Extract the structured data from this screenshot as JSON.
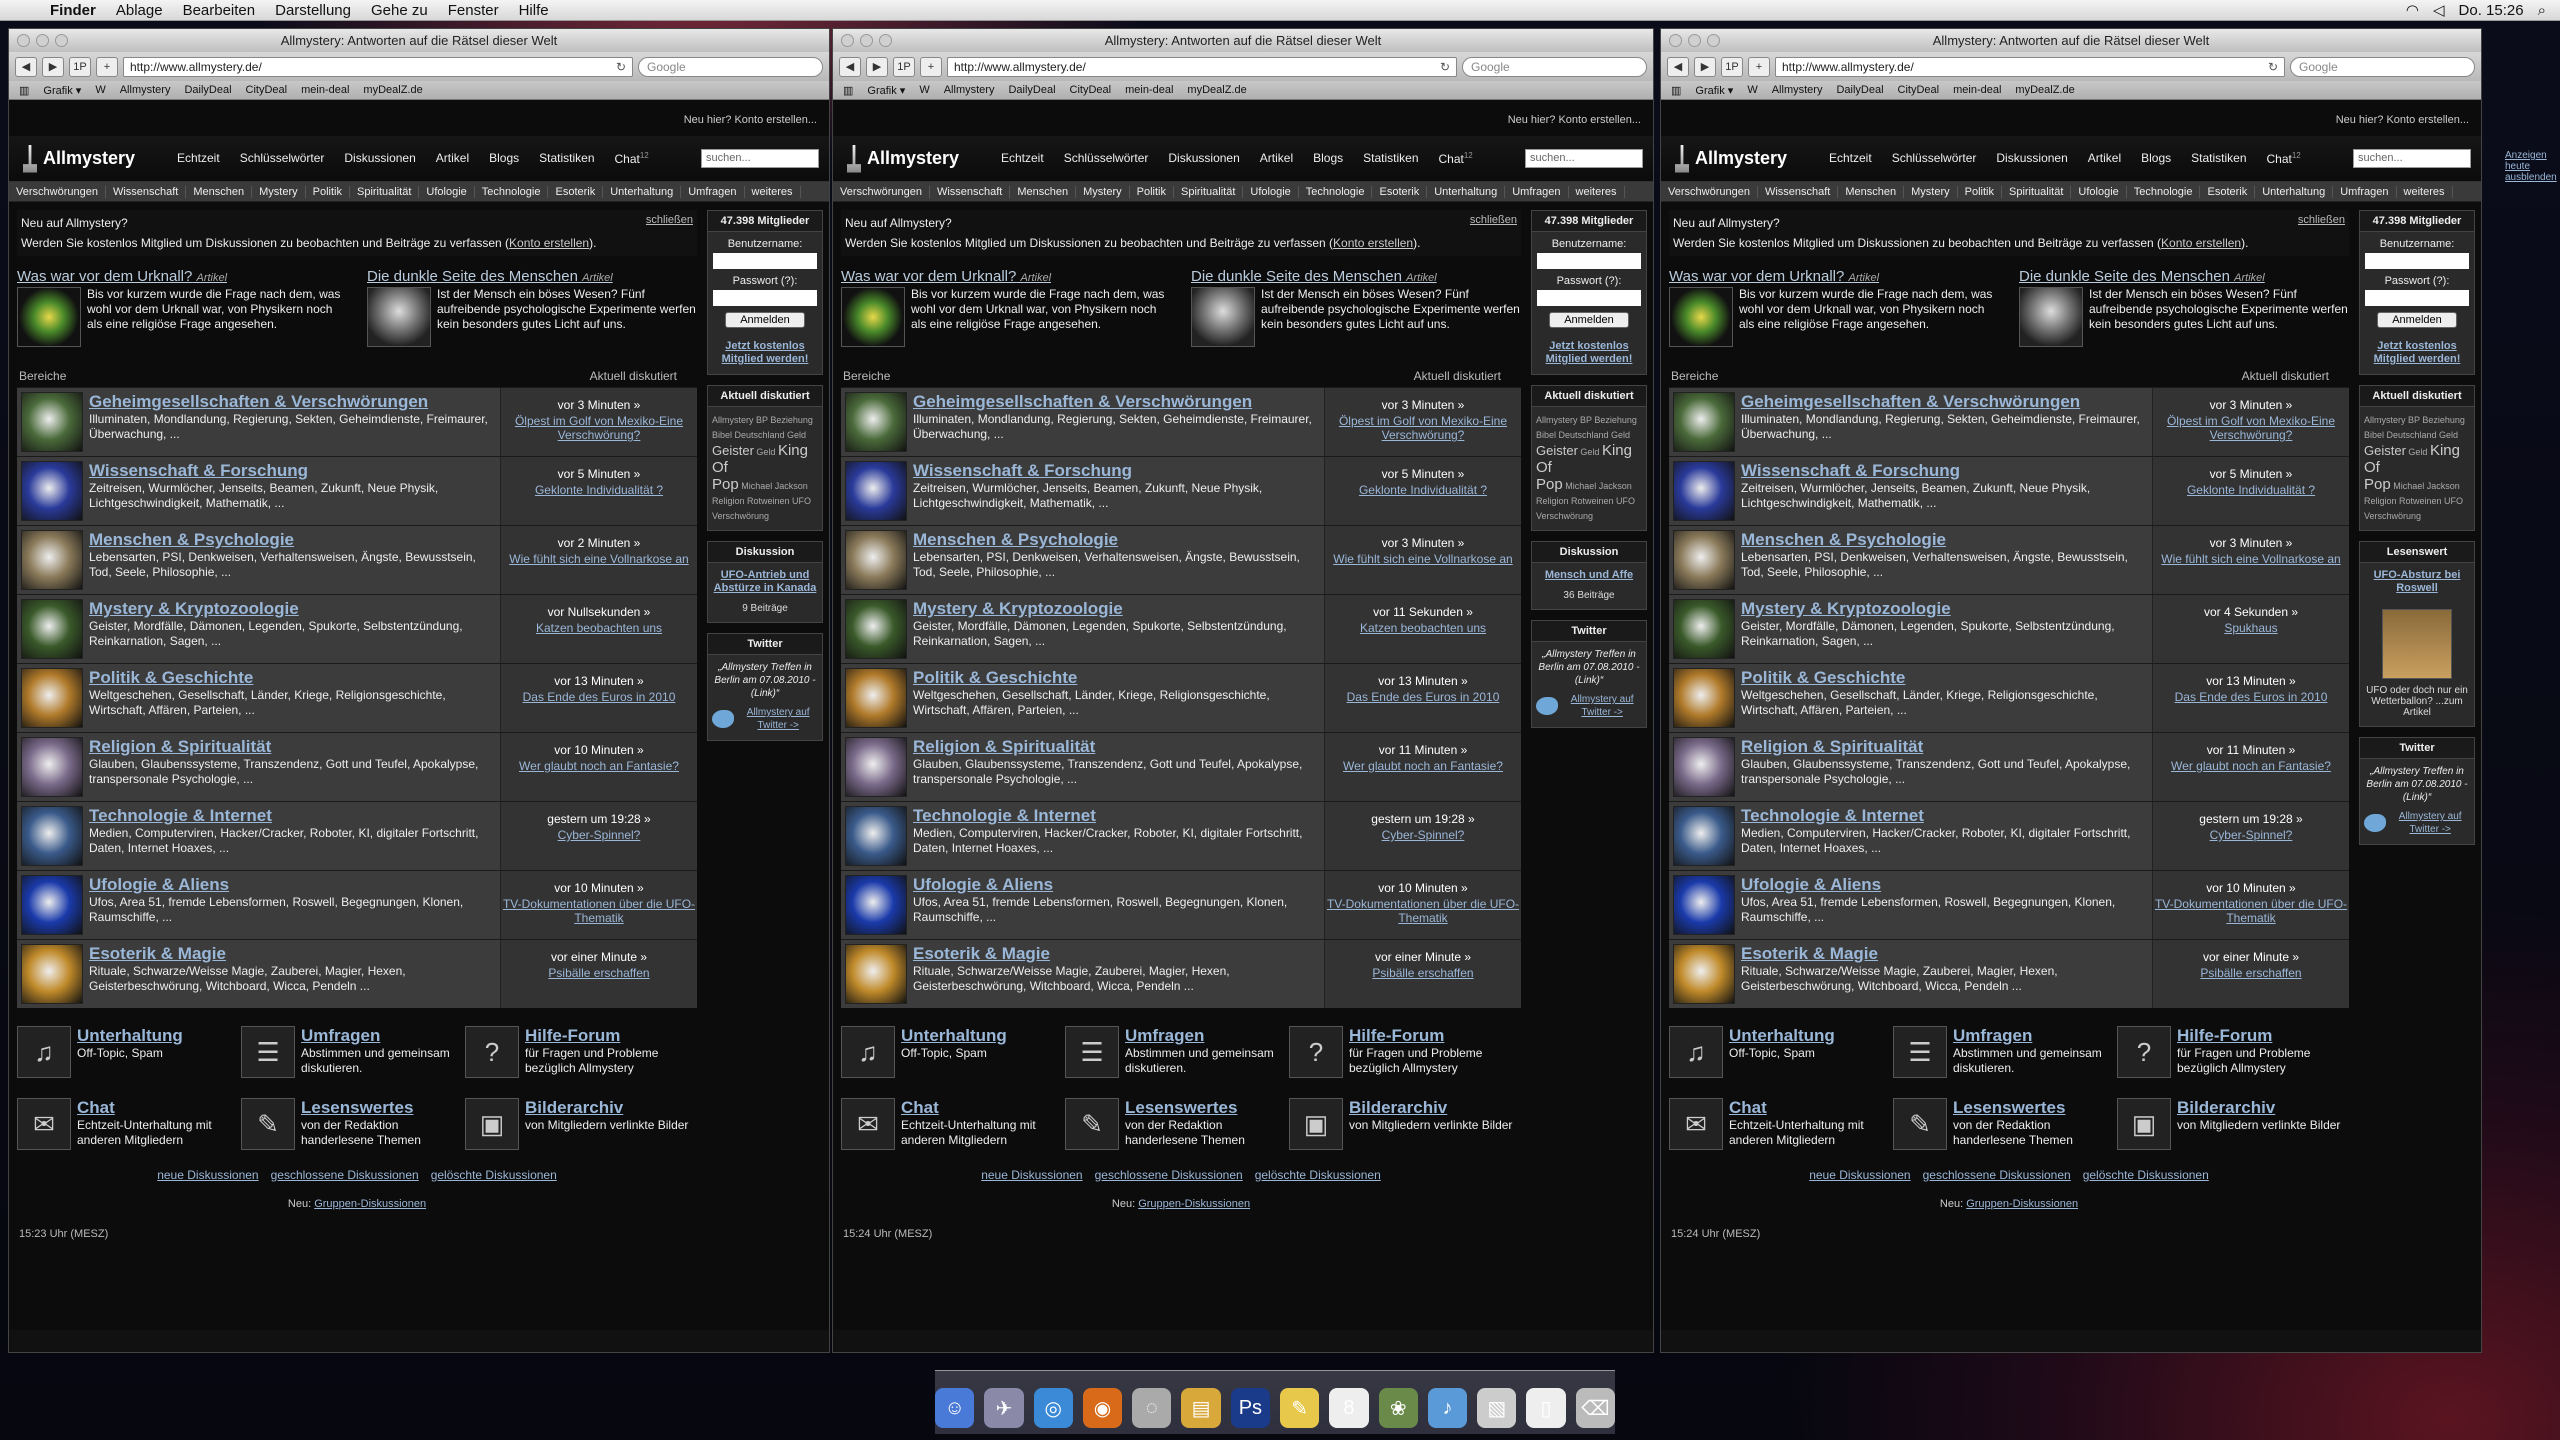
{
  "menubar": {
    "items": [
      "Finder",
      "Ablage",
      "Bearbeiten",
      "Darstellung",
      "Gehe zu",
      "Fenster",
      "Hilfe"
    ],
    "clock": "Do. 15:26"
  },
  "browser": {
    "title": "Allmystery: Antworten auf die Rätsel dieser Welt",
    "url": "http://www.allmystery.de/",
    "google": "Google",
    "bookmarks": [
      "Grafik ▾",
      "W",
      "Allmystery",
      "DailyDeal",
      "CityDeal",
      "mein-deal",
      "myDealZ.de"
    ]
  },
  "site": {
    "newhere": "Neu hier? Konto erstellen...",
    "logo": "Allmystery",
    "nav": [
      "Echtzeit",
      "Schlüsselwörter",
      "Diskussionen",
      "Artikel",
      "Blogs",
      "Statistiken",
      "Chat"
    ],
    "chat_count": "12",
    "search_placeholder": "suchen...",
    "categories": [
      "Verschwörungen",
      "Wissenschaft",
      "Menschen",
      "Mystery",
      "Politik",
      "Spiritualität",
      "Ufologie",
      "Technologie",
      "Esoterik",
      "Unterhaltung",
      "Umfragen",
      "weiteres"
    ],
    "welcome": {
      "title": "Neu auf Allmystery?",
      "text": "Werden Sie kostenlos Mitglied um Diskussionen zu beobachten und Beiträge zu verfassen (",
      "link": "Konto erstellen",
      "end": ").",
      "close": "schließen"
    },
    "features": [
      {
        "title": "Was war vor dem Urknall?",
        "type": "Artikel",
        "text": "Bis vor kurzem wurde die Frage nach dem, was wohl vor dem Urknall war, von Physikern noch als eine religiöse Frage angesehen."
      },
      {
        "title": "Die dunkle Seite des Menschen",
        "type": "Artikel",
        "text": "Ist der Mensch ein böses Wesen? Fünf aufreibende psychologische Experimente werfen kein besonders gutes Licht auf uns."
      }
    ],
    "bereiche": "Bereiche",
    "aktuell": "Aktuell diskutiert",
    "forums": [
      {
        "title": "Geheimgesellschaften & Verschwörungen",
        "desc": "Illuminaten, Mondlandung, Regierung, Sekten, Geheimdienste, Freimaurer, Überwachung, ...",
        "color": "#4a6a3a"
      },
      {
        "title": "Wissenschaft & Forschung",
        "desc": "Zeitreisen, Wurmlöcher, Jenseits, Beamen, Zukunft, Neue Physik, Lichtgeschwindigkeit, Mathematik, ...",
        "color": "#2a3a9a"
      },
      {
        "title": "Menschen & Psychologie",
        "desc": "Lebensarten, PSI, Denkweisen, Verhaltensweisen, Ängste, Bewusstsein, Tod, Seele, Philosophie, ...",
        "color": "#8a7a5a"
      },
      {
        "title": "Mystery & Kryptozoologie",
        "desc": "Geister, Mordfälle, Dämonen, Legenden, Spukorte, Selbstentzündung, Reinkarnation, Sagen, ...",
        "color": "#3a5a2a"
      },
      {
        "title": "Politik & Geschichte",
        "desc": "Weltgeschehen, Gesellschaft, Länder, Kriege, Religionsgeschichte, Wirtschaft, Affären, Parteien, ...",
        "color": "#b07a2a"
      },
      {
        "title": "Religion & Spiritualität",
        "desc": "Glauben, Glaubenssysteme, Transzendenz, Gott und Teufel, Apokalypse, transpersonale Psychologie, ...",
        "color": "#7a6a8a"
      },
      {
        "title": "Technologie & Internet",
        "desc": "Medien, Computerviren, Hacker/Cracker, Roboter, KI, digitaler Fortschritt, Daten, Internet Hoaxes, ...",
        "color": "#3a5a8a"
      },
      {
        "title": "Ufologie & Aliens",
        "desc": "Ufos, Area 51, fremde Lebensformen, Roswell, Begegnungen, Klonen, Raumschiffe, ...",
        "color": "#1a3aaa"
      },
      {
        "title": "Esoterik & Magie",
        "desc": "Rituale, Schwarze/Weisse Magie, Zauberei, Magier, Hexen, Geisterbeschwörung, Witchboard, Wicca, Pendeln ...",
        "color": "#c08a2a"
      }
    ],
    "extras": [
      {
        "title": "Unterhaltung",
        "desc": "Off-Topic, Spam",
        "icon": "♫"
      },
      {
        "title": "Umfragen",
        "desc": "Abstimmen und gemeinsam diskutieren.",
        "icon": "☰"
      },
      {
        "title": "Hilfe-Forum",
        "desc": "für Fragen und Probleme bezüglich Allmystery",
        "icon": "?"
      },
      {
        "title": "Chat",
        "desc": "Echtzeit-Unterhaltung mit anderen Mitgliedern",
        "icon": "✉"
      },
      {
        "title": "Lesenswertes",
        "desc": "von der Redaktion handerlesene Themen",
        "icon": "✎"
      },
      {
        "title": "Bilderarchiv",
        "desc": "von Mitgliedern verlinkte Bilder",
        "icon": "▣"
      }
    ],
    "footlinks": [
      "neue Diskussionen",
      "geschlossene Diskussionen",
      "gelöschte Diskussionen"
    ],
    "neu_label": "Neu:",
    "neu_link": "Gruppen-Diskussionen",
    "members": "47.398 Mitglieder",
    "username": "Benutzername:",
    "password": "Passwort (?):",
    "login": "Anmelden",
    "join": "Jetzt kostenlos Mitglied werden!",
    "aktuell_box": "Aktuell diskutiert",
    "tags_small": "Allmystery BP Beziehung Bibel Deutschland Geld",
    "tags_big1": "Geister",
    "tags_mid": "Geld",
    "tags_big2": "King Of",
    "tags_big3": "Pop",
    "tags_small2": "Michael Jackson Religion Rotweinen UFO Verschwörung",
    "twitter": "Twitter",
    "tweet": "„Allmystery Treffen in Berlin am 07.08.2010 - (Link)“",
    "twitter_link": "Allmystery auf Twitter ->"
  },
  "windows": [
    {
      "times": [
        "vor 3 Minuten »",
        "vor 5 Minuten »",
        "vor 2 Minuten »",
        "vor Nullsekunden »",
        "vor 13 Minuten »",
        "vor 10 Minuten »",
        "gestern um 19:28 »",
        "vor 10 Minuten »",
        "vor einer Minute »"
      ],
      "topics": [
        "Ölpest im Golf von Mexiko-Eine Verschwörung?",
        "Geklonte Individualität ?",
        "Wie fühlt sich eine Vollnarkose an",
        "Katzen beobachten uns",
        "Das Ende des Euros in 2010",
        "Wer glaubt noch an Fantasie?",
        "Cyber-Spinnel?",
        "TV-Dokumentationen über die UFO-Thematik",
        "Psibälle erschaffen"
      ],
      "box3_head": "Diskussion",
      "box3_link": "UFO-Antrieb und Abstürze in Kanada",
      "box3_sub": "9 Beiträge",
      "clock": "15:23 Uhr (MESZ)"
    },
    {
      "times": [
        "vor 3 Minuten »",
        "vor 5 Minuten »",
        "vor 3 Minuten »",
        "vor 11 Sekunden »",
        "vor 13 Minuten »",
        "vor 11 Minuten »",
        "gestern um 19:28 »",
        "vor 10 Minuten »",
        "vor einer Minute »"
      ],
      "topics": [
        "Ölpest im Golf von Mexiko-Eine Verschwörung?",
        "Geklonte Individualität ?",
        "Wie fühlt sich eine Vollnarkose an",
        "Katzen beobachten uns",
        "Das Ende des Euros in 2010",
        "Wer glaubt noch an Fantasie?",
        "Cyber-Spinnel?",
        "TV-Dokumentationen über die UFO-Thematik",
        "Psibälle erschaffen"
      ],
      "box3_head": "Diskussion",
      "box3_link": "Mensch und Affe",
      "box3_sub": "36 Beiträge",
      "clock": "15:24 Uhr (MESZ)"
    },
    {
      "times": [
        "vor 3 Minuten »",
        "vor 5 Minuten »",
        "vor 3 Minuten »",
        "vor 4 Sekunden »",
        "vor 13 Minuten »",
        "vor 11 Minuten »",
        "gestern um 19:28 »",
        "vor 10 Minuten »",
        "vor einer Minute »"
      ],
      "topics": [
        "Ölpest im Golf von Mexiko-Eine Verschwörung?",
        "Geklonte Individualität ?",
        "Wie fühlt sich eine Vollnarkose an",
        "Spukhaus",
        "Das Ende des Euros in 2010",
        "Wer glaubt noch an Fantasie?",
        "Cyber-Spinnel?",
        "TV-Dokumentationen über die UFO-Thematik",
        "Psibälle erschaffen"
      ],
      "box3_head": "Lesenswert",
      "box3_link": "UFO-Absturz bei Roswell",
      "box3_sub": "UFO oder doch nur ein Wetterballon? ...zum Artikel",
      "clock": "15:24 Uhr (MESZ)"
    }
  ],
  "ad_side": "Anzeigen heute ausblenden",
  "dock": [
    {
      "name": "finder",
      "color": "#4a7ad8",
      "glyph": "☺"
    },
    {
      "name": "preview",
      "color": "#8a8aa8",
      "glyph": "✈"
    },
    {
      "name": "safari",
      "color": "#3a8ad8",
      "glyph": "◎"
    },
    {
      "name": "firefox",
      "color": "#d86a1a",
      "glyph": "◉"
    },
    {
      "name": "ichat",
      "color": "#aaa",
      "glyph": "◌"
    },
    {
      "name": "transmit",
      "color": "#d8a83a",
      "glyph": "▤"
    },
    {
      "name": "photoshop",
      "color": "#1a3a8a",
      "glyph": "Ps"
    },
    {
      "name": "stickies",
      "color": "#e8c84a",
      "glyph": "✎"
    },
    {
      "name": "ical",
      "color": "#eee",
      "glyph": "8"
    },
    {
      "name": "iphoto",
      "color": "#6a8a4a",
      "glyph": "❀"
    },
    {
      "name": "itunes",
      "color": "#5a9ad8",
      "glyph": "♪"
    },
    {
      "name": "screenshot",
      "color": "#ccc",
      "glyph": "▧"
    },
    {
      "name": "documents",
      "color": "#eee",
      "glyph": "▯"
    },
    {
      "name": "trash",
      "color": "#bbb",
      "glyph": "⌫"
    }
  ]
}
